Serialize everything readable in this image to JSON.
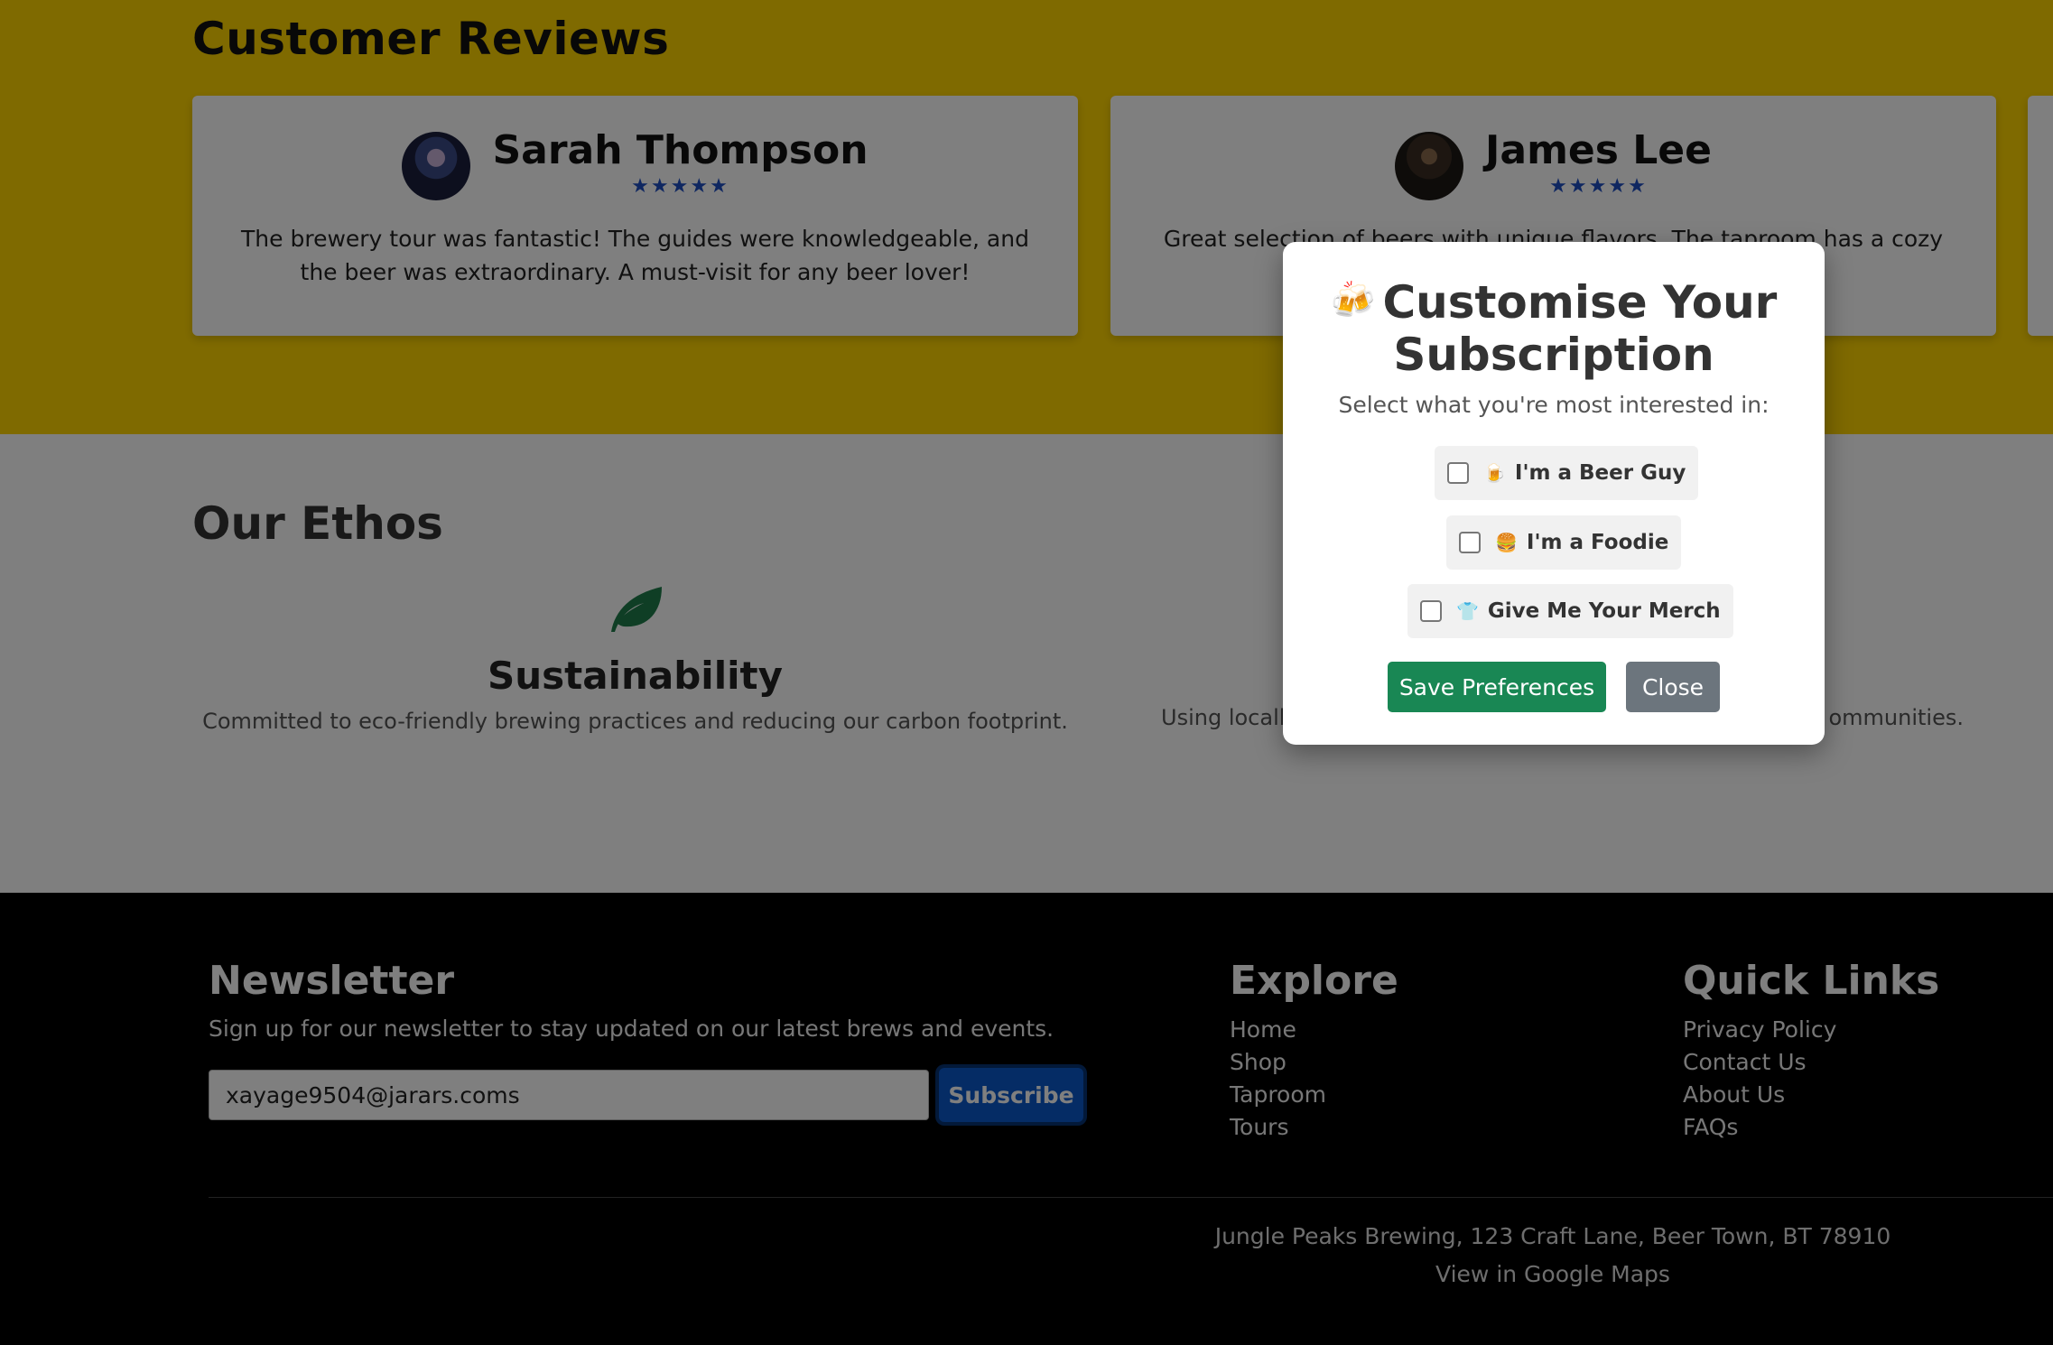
{
  "reviews": {
    "title": "Customer Reviews",
    "items": [
      {
        "name": "Sarah Thompson",
        "stars": "★★★★★",
        "text": "The brewery tour was fantastic! The guides were knowledgeable, and the beer was extraordinary. A must-visit for any beer lover!"
      },
      {
        "name": "James Lee",
        "stars": "★★★★★",
        "text": "Great selection of beers with unique flavors. The taproom has a cozy vibe,"
      }
    ]
  },
  "ethos": {
    "title": "Our Ethos",
    "items": [
      {
        "title": "Sustainability",
        "desc": "Committed to eco-friendly brewing practices and reducing our carbon footprint.",
        "icon": "leaf-icon"
      },
      {
        "desc_left": "Using locally",
        "desc_right": "ommunities."
      }
    ]
  },
  "footer": {
    "newsletter_title": "Newsletter",
    "newsletter_text": "Sign up for our newsletter to stay updated on our latest brews and events.",
    "email_value": "xayage9504@jarars.coms",
    "subscribe_label": "Subscribe",
    "explore_title": "Explore",
    "explore_links": [
      "Home",
      "Shop",
      "Taproom",
      "Tours"
    ],
    "quick_title": "Quick Links",
    "quick_links": [
      "Privacy Policy",
      "Contact Us",
      "About Us",
      "FAQs"
    ],
    "address": "Jungle Peaks Brewing, 123 Craft Lane, Beer Town, BT 78910",
    "maps_link": "View in Google Maps"
  },
  "modal": {
    "icon": "🍻",
    "title": "Customise Your Subscription",
    "subtitle": "Select what you're most interested in:",
    "options": [
      {
        "emoji": "🍺",
        "label": "I'm a Beer Guy"
      },
      {
        "emoji": "🍔",
        "label": "I'm a Foodie"
      },
      {
        "emoji": "👕",
        "label": "Give Me Your Merch"
      }
    ],
    "save_label": "Save Preferences",
    "close_label": "Close"
  },
  "colors": {
    "reviews_bg": "#ffd500",
    "star": "#1f4fc2",
    "save_button": "#198754",
    "close_button": "#6c757d",
    "subscribe_button": "#0a58ca",
    "leaf": "#1e7d4a"
  }
}
